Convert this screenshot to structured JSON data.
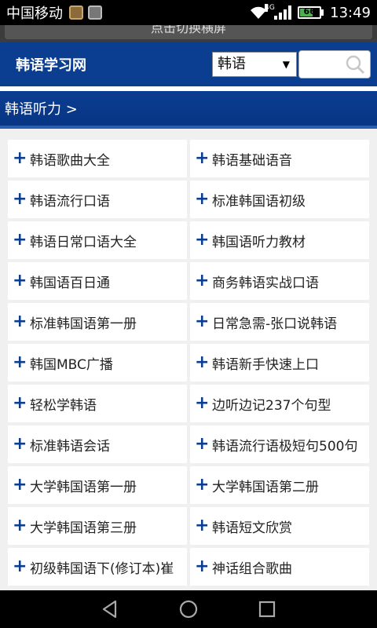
{
  "status_bar": {
    "carrier": "中国移动",
    "network": "4G",
    "battery": "66",
    "battery_level": 0.66,
    "time": "13:49",
    "icons": [
      "notification-icon",
      "gallery-icon",
      "wifi-icon",
      "signal-icon",
      "battery-icon"
    ]
  },
  "banner": {
    "rotate_text": "点击切换横屏"
  },
  "header": {
    "site_title": "韩语学习网",
    "select_value": "韩语",
    "search_placeholder": ""
  },
  "breadcrumb": {
    "label": "韩语听力 >"
  },
  "colors": {
    "brand": "#0b3d91",
    "plus": "#0b3d91"
  },
  "items": [
    "韩语歌曲大全",
    "韩语基础语音",
    "韩语流行口语",
    "标准韩国语初级",
    "韩语日常口语大全",
    "韩国语听力教材",
    "韩国语百日通",
    "商务韩语实战口语",
    "标准韩国语第一册",
    "日常急需-张口说韩语",
    "韩国MBC广播",
    "韩语新手快速上口",
    "轻松学韩语",
    "边听边记237个句型",
    "标准韩语会话",
    "韩语流行语极短句500句",
    "大学韩国语第一册",
    "大学韩国语第二册",
    "大学韩国语第三册",
    "韩语短文欣赏",
    "初级韩国语下(修订本)崔",
    "神话组合歌曲"
  ],
  "nav": [
    "back-icon",
    "home-icon",
    "recents-icon"
  ]
}
